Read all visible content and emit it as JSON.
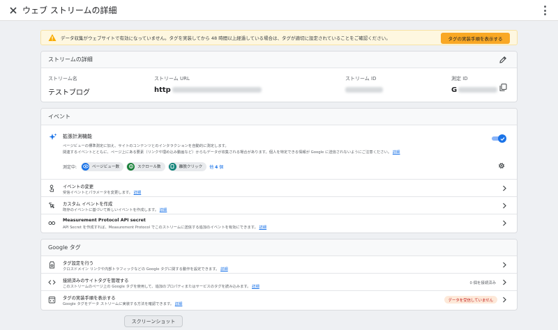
{
  "topbar": {
    "title": "ウェブ ストリームの詳細",
    "close_icon": "close-icon",
    "menu_icon": "more-vert-icon"
  },
  "banner": {
    "icon": "warning-icon",
    "text": "データ収集がウェブサイトで有効になっていません。タグを実装してから 48 時間以上経過している場合は、タグが適切に設定されていることをご確認ください。",
    "button_label": "タグの実装手順を表示する",
    "colors": {
      "background": "#fef7e0",
      "button": "#f9a825"
    }
  },
  "stream_details": {
    "header": "ストリームの詳細",
    "edit_icon": "pencil-icon",
    "name_label": "ストリーム名",
    "name_value": "テストブログ",
    "url_label": "ストリーム URL",
    "url_value": "http",
    "id_label": "ストリーム ID",
    "measurement_label": "測定 ID",
    "measurement_value": "G",
    "copy_icon": "copy-icon"
  },
  "events": {
    "header": "イベント",
    "enhanced": {
      "icon": "sparkle-icon",
      "title": "拡張計測機能",
      "desc_line1": "ページビューの標準測定に加え、サイトのコンテンツとのインタラクションを自動的に測定します。",
      "desc_line2": "関連するイベントとともに、ページ上にある要素（リンクや埋め込み動画など）からもデータが収集される場合があります。個人を特定できる情報が Google に送信されないようにご注意ください。",
      "desc_link": "詳細",
      "toggle_on": true,
      "measuring_label": "測定中:",
      "chips": [
        {
          "label": "ページビュー数",
          "icon": "eye-icon",
          "color": "#1a73e8"
        },
        {
          "label": "スクロール数",
          "icon": "scroll-icon",
          "color": "#188038"
        },
        {
          "label": "離脱クリック",
          "icon": "click-icon",
          "color": "#12837a"
        }
      ],
      "more_prefix": "他",
      "more_count": "4",
      "more_suffix": "個",
      "settings_icon": "gear-icon"
    },
    "rows": [
      {
        "icon": "touch-icon",
        "title": "イベントの変更",
        "sub": "受信イベントとパラメータを変更します。",
        "link": "詳細"
      },
      {
        "icon": "custom-event-icon",
        "title": "カスタム イベントを作成",
        "sub": "既存のイベントに基づいて新しいイベントを作成します。",
        "link": "詳細"
      },
      {
        "icon": "key-icon",
        "title": "Measurement Protocol API secret",
        "sub": "API Secret を作成すれば、Measurement Protocol でこのストリームに送信する追加のイベントを有効にできます。",
        "link": "詳細"
      }
    ]
  },
  "google_tag": {
    "header": "Google タグ",
    "rows": [
      {
        "icon": "tag-settings-icon",
        "title": "タグ設定を行う",
        "sub": "クロスドメイン リンクや内部トラフィックなどの Google タグに関する動作を設定できます。",
        "link": "詳細"
      },
      {
        "icon": "code-icon",
        "title": "接続済みのサイトタグを管理する",
        "sub": "このストリームのページ上の Google タグを使用して、追加のプロパティまたはサービスのタグを読み込みます。",
        "link": "詳細",
        "meta": "0 個を接続済み"
      },
      {
        "icon": "instructions-icon",
        "title": "タグの実装手順を表示する",
        "sub": "Google タグをデータ ストリームに実装する方法を確認できます。",
        "link": "詳細",
        "badge": "データを受信していません"
      }
    ]
  },
  "screenshot_button": "スクリーンショット"
}
